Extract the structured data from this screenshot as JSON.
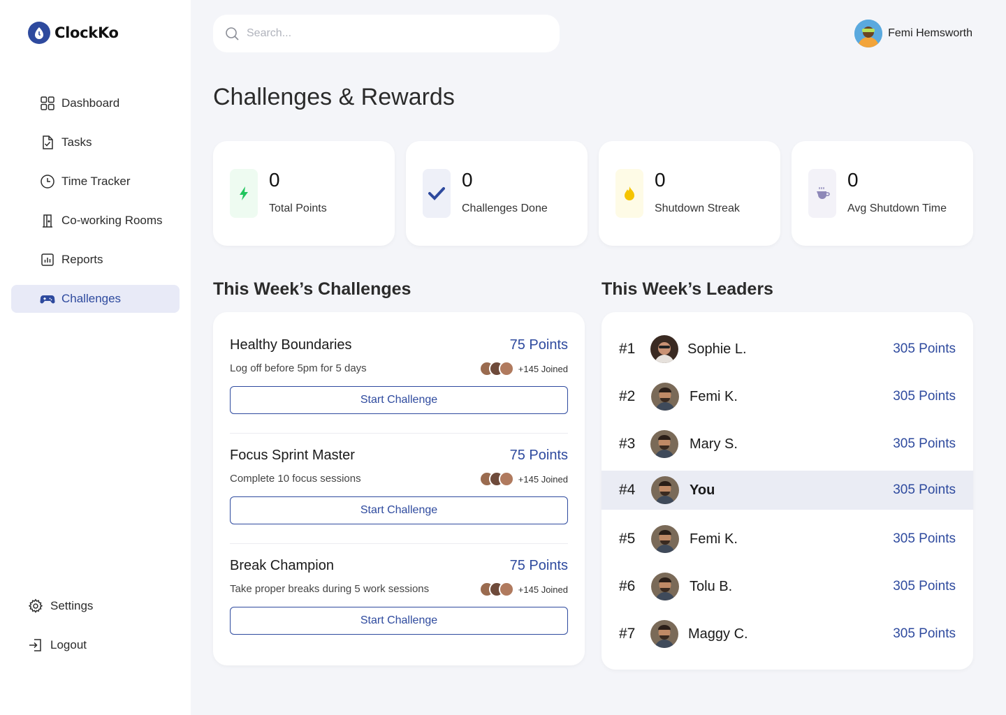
{
  "app": {
    "name": "ClockKo"
  },
  "sidebar": {
    "items": [
      {
        "label": "Dashboard",
        "icon": "grid-icon"
      },
      {
        "label": "Tasks",
        "icon": "file-check-icon"
      },
      {
        "label": "Time Tracker",
        "icon": "clock-icon"
      },
      {
        "label": "Co-working Rooms",
        "icon": "door-icon"
      },
      {
        "label": "Reports",
        "icon": "chart-icon"
      },
      {
        "label": "Challenges",
        "icon": "gamepad-icon",
        "active": true
      }
    ],
    "bottom": [
      {
        "label": "Settings",
        "icon": "gear-icon"
      },
      {
        "label": "Logout",
        "icon": "logout-icon"
      }
    ]
  },
  "search": {
    "placeholder": "Search..."
  },
  "user": {
    "name": "Femi Hemsworth"
  },
  "page": {
    "title": "Challenges & Rewards"
  },
  "stats": [
    {
      "value": "0",
      "label": "Total Points",
      "icon": "lightning-icon",
      "color": "#22c55e",
      "bg": "#eefbf1"
    },
    {
      "value": "0",
      "label": "Challenges Done",
      "icon": "check-icon",
      "color": "#2e4a9e",
      "bg": "#eef0f8"
    },
    {
      "value": "0",
      "label": "Shutdown Streak",
      "icon": "flame-icon",
      "color": "#f5c400",
      "bg": "#fefbe6"
    },
    {
      "value": "0",
      "label": "Avg Shutdown Time",
      "icon": "coffee-icon",
      "color": "#8e88b8",
      "bg": "#f3f2f8"
    }
  ],
  "challenges_section": {
    "title": "This Week’s Challenges",
    "items": [
      {
        "title": "Healthy Boundaries",
        "points": "75 Points",
        "description": "Log off before 5pm for 5 days",
        "joined": "+145 Joined",
        "button": "Start Challenge"
      },
      {
        "title": "Focus Sprint Master",
        "points": "75 Points",
        "description": "Complete 10 focus sessions",
        "joined": "+145 Joined",
        "button": "Start Challenge"
      },
      {
        "title": "Break Champion",
        "points": "75 Points",
        "description": "Take proper breaks during 5 work sessions",
        "joined": "+145 Joined",
        "button": "Start Challenge"
      }
    ]
  },
  "leaders_section": {
    "title": "This Week’s Leaders",
    "rows": [
      {
        "rank": "#1",
        "name": "Sophie L.",
        "points": "305 Points"
      },
      {
        "rank": "#2",
        "name": "Femi K.",
        "points": "305 Points"
      },
      {
        "rank": "#3",
        "name": "Mary S.",
        "points": "305 Points"
      },
      {
        "rank": "#4",
        "name": "You",
        "points": "305 Points",
        "highlight": true
      },
      {
        "rank": "#5",
        "name": "Femi K.",
        "points": "305 Points"
      },
      {
        "rank": "#6",
        "name": "Tolu B.",
        "points": "305 Points"
      },
      {
        "rank": "#7",
        "name": "Maggy C.",
        "points": "305 Points"
      }
    ]
  },
  "colors": {
    "accent": "#2e4a9e",
    "background": "#f4f5f9",
    "active_nav": "#e8eaf7"
  }
}
